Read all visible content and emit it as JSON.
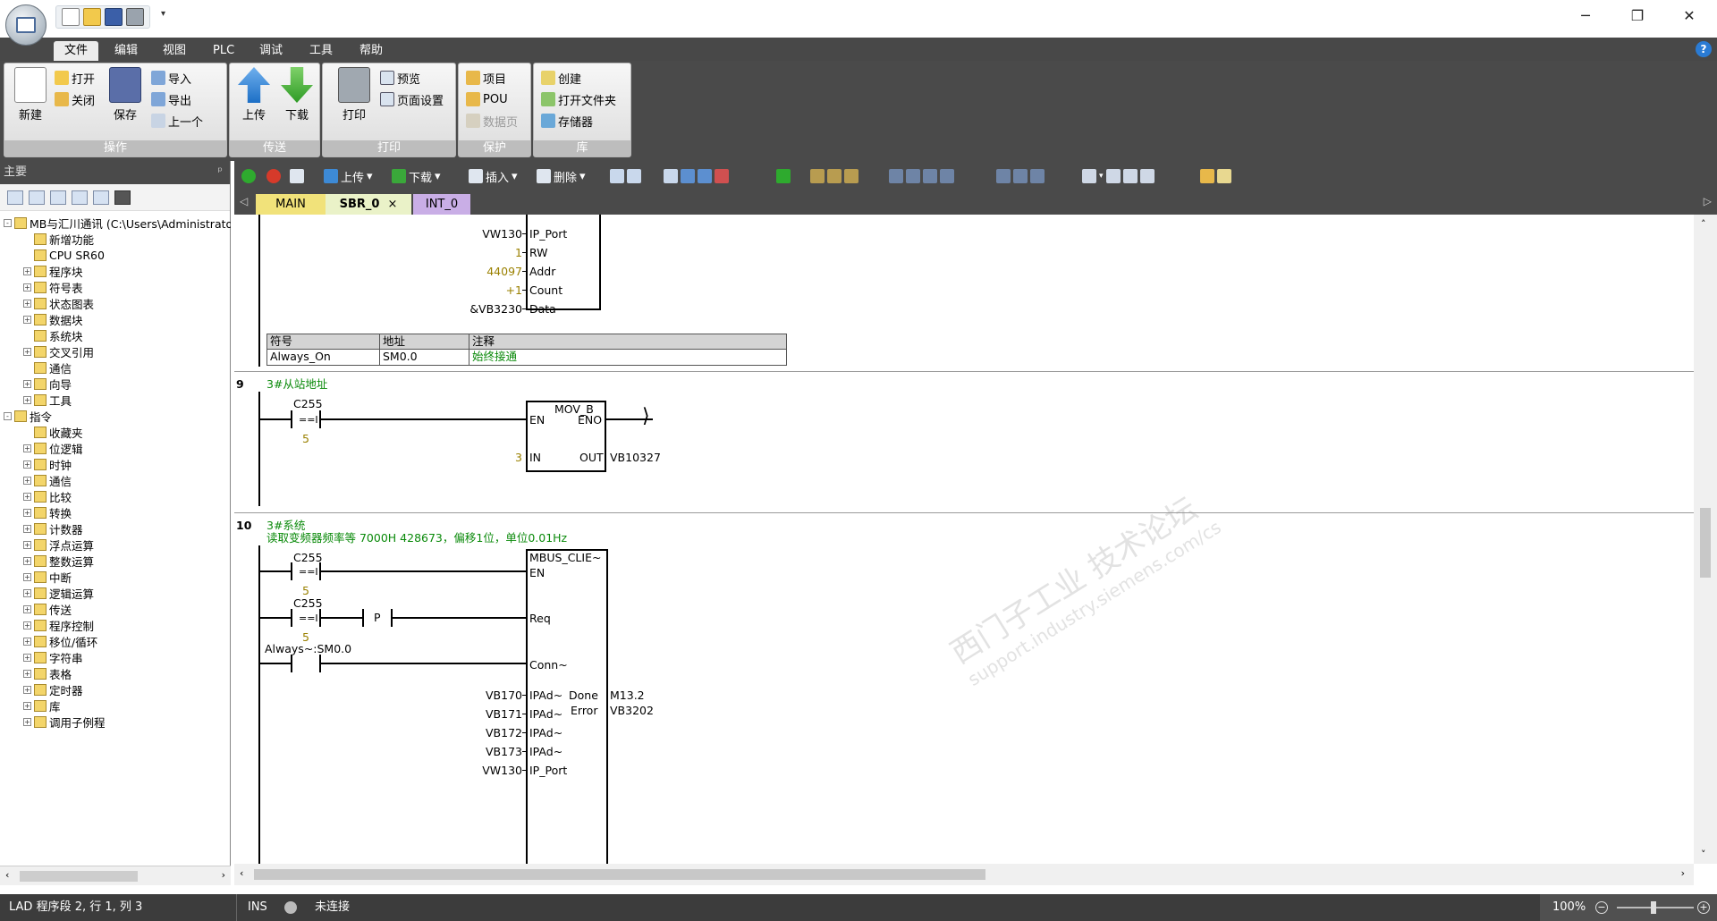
{
  "titlebar": {
    "minimize": "─",
    "restore": "❐",
    "close": "✕",
    "qat_dropdown": "▾"
  },
  "menu": {
    "items": [
      "文件",
      "编辑",
      "视图",
      "PLC",
      "调试",
      "工具",
      "帮助"
    ],
    "active": "文件",
    "help": "?"
  },
  "ribbon": {
    "groups": [
      {
        "label": "操作",
        "big": [
          "新建",
          "保存"
        ],
        "small": [
          "打开",
          "关闭",
          "导入",
          "导出",
          "上一个"
        ]
      },
      {
        "label": "传送",
        "big": [
          "上传",
          "下载"
        ]
      },
      {
        "label": "打印",
        "big": [
          "打印"
        ],
        "small": [
          "预览",
          "页面设置"
        ]
      },
      {
        "label": "保护",
        "small": [
          "项目",
          "POU",
          "数据页"
        ]
      },
      {
        "label": "库",
        "small": [
          "创建",
          "打开文件夹",
          "存储器"
        ]
      }
    ]
  },
  "panel": {
    "title": "主要",
    "pin": "ᵖ",
    "tree": [
      {
        "label": "MB与汇川通讯 (C:\\Users\\Administrato",
        "level": 0,
        "exp": "-"
      },
      {
        "label": "新增功能",
        "level": 1,
        "exp": ""
      },
      {
        "label": "CPU SR60",
        "level": 1,
        "exp": ""
      },
      {
        "label": "程序块",
        "level": 1,
        "exp": "+"
      },
      {
        "label": "符号表",
        "level": 1,
        "exp": "+"
      },
      {
        "label": "状态图表",
        "level": 1,
        "exp": "+"
      },
      {
        "label": "数据块",
        "level": 1,
        "exp": "+"
      },
      {
        "label": "系统块",
        "level": 1,
        "exp": ""
      },
      {
        "label": "交叉引用",
        "level": 1,
        "exp": "+"
      },
      {
        "label": "通信",
        "level": 1,
        "exp": ""
      },
      {
        "label": "向导",
        "level": 1,
        "exp": "+"
      },
      {
        "label": "工具",
        "level": 1,
        "exp": "+"
      },
      {
        "label": "指令",
        "level": 0,
        "exp": "-"
      },
      {
        "label": "收藏夹",
        "level": 1,
        "exp": ""
      },
      {
        "label": "位逻辑",
        "level": 1,
        "exp": "+"
      },
      {
        "label": "时钟",
        "level": 1,
        "exp": "+"
      },
      {
        "label": "通信",
        "level": 1,
        "exp": "+"
      },
      {
        "label": "比较",
        "level": 1,
        "exp": "+"
      },
      {
        "label": "转换",
        "level": 1,
        "exp": "+"
      },
      {
        "label": "计数器",
        "level": 1,
        "exp": "+"
      },
      {
        "label": "浮点运算",
        "level": 1,
        "exp": "+"
      },
      {
        "label": "整数运算",
        "level": 1,
        "exp": "+"
      },
      {
        "label": "中断",
        "level": 1,
        "exp": "+"
      },
      {
        "label": "逻辑运算",
        "level": 1,
        "exp": "+"
      },
      {
        "label": "传送",
        "level": 1,
        "exp": "+"
      },
      {
        "label": "程序控制",
        "level": 1,
        "exp": "+"
      },
      {
        "label": "移位/循环",
        "level": 1,
        "exp": "+"
      },
      {
        "label": "字符串",
        "level": 1,
        "exp": "+"
      },
      {
        "label": "表格",
        "level": 1,
        "exp": "+"
      },
      {
        "label": "定时器",
        "level": 1,
        "exp": "+"
      },
      {
        "label": "库",
        "level": 1,
        "exp": "+"
      },
      {
        "label": "调用子例程",
        "level": 1,
        "exp": "+"
      }
    ]
  },
  "editor_toolbar": {
    "upload": "上传",
    "download": "下载",
    "insert": "插入",
    "delete": "删除"
  },
  "tabs": [
    "MAIN",
    "SBR_0",
    "INT_0"
  ],
  "tabs_close": "×",
  "networks": {
    "top_block": {
      "pins": [
        {
          "value": "VW130",
          "name": "IP_Port",
          "olive": false
        },
        {
          "value": "1",
          "name": "RW",
          "olive": true
        },
        {
          "value": "44097",
          "name": "Addr",
          "olive": true
        },
        {
          "value": "+1",
          "name": "Count",
          "olive": true
        },
        {
          "value": "&VB3230",
          "name": "Data~",
          "olive": false
        }
      ]
    },
    "symbol_table": {
      "headers": [
        "符号",
        "地址",
        "注释"
      ],
      "row": [
        "Always_On",
        "SM0.0",
        "始终接通"
      ]
    },
    "n9": {
      "num": "9",
      "comment": "3#从站地址",
      "contact_addr": "C255",
      "contact_op": "==I",
      "contact_val": "5",
      "box_title": "MOV_B",
      "en": "EN",
      "eno": "ENO",
      "in": "IN",
      "out": "OUT",
      "in_val": "3",
      "out_val": "VB10327"
    },
    "n10": {
      "num": "10",
      "comment1": "3#系统",
      "comment2": "读取变频器频率等 7000H 428673，偏移1位，单位0.01Hz",
      "c1_addr": "C255",
      "c1_op": "==I",
      "c1_val": "5",
      "c2_addr": "C255",
      "c2_op": "==I",
      "c2_val": "5",
      "p": "P",
      "c3_addr": "Always~:SM0.0",
      "box_title": "MBUS_CLIE~",
      "en": "EN",
      "req": "Req",
      "conn": "Conn~",
      "inputs": [
        {
          "value": "VB170",
          "name": "IPAd~"
        },
        {
          "value": "VB171",
          "name": "IPAd~"
        },
        {
          "value": "VB172",
          "name": "IPAd~"
        },
        {
          "value": "VB173",
          "name": "IPAd~"
        },
        {
          "value": "VW130",
          "name": "IP_Port"
        }
      ],
      "done": "Done",
      "done_val": "M13.2",
      "error": "Error",
      "error_val": "VB3202"
    }
  },
  "watermark": {
    "line1": "西门子工业  技术论坛",
    "line2": "support.industry.siemens.com/cs"
  },
  "status": {
    "position": "LAD 程序段 2, 行 1, 列 3",
    "mode": "INS",
    "conn": "未连接",
    "zoom": "100%"
  }
}
